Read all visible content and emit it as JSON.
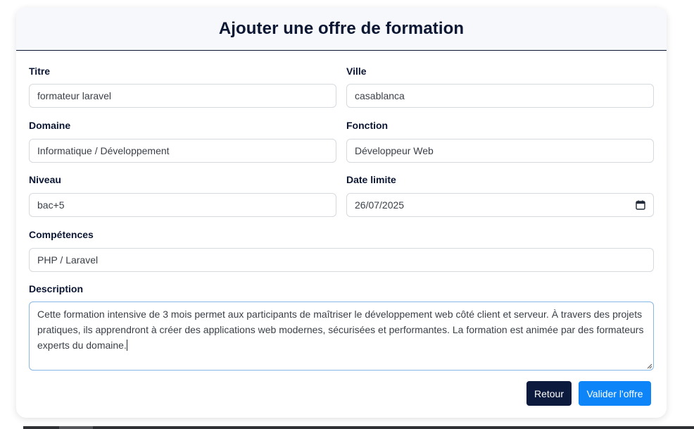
{
  "page": {
    "title": "Ajouter une offre de formation"
  },
  "fields": {
    "titre": {
      "label": "Titre",
      "value": "formateur laravel"
    },
    "ville": {
      "label": "Ville",
      "value": "casablanca"
    },
    "domaine": {
      "label": "Domaine",
      "value": "Informatique / Développement"
    },
    "fonction": {
      "label": "Fonction",
      "value": "Développeur Web"
    },
    "niveau": {
      "label": "Niveau",
      "value": "bac+5"
    },
    "date_limite": {
      "label": "Date limite",
      "value": "26/07/2025",
      "icon": "calendar-icon"
    },
    "competences": {
      "label": "Compétences",
      "value": "PHP / Laravel"
    },
    "description": {
      "label": "Description",
      "lines": [
        "Cette formation intensive de 3 mois permet aux participants de maîtriser le développement web côté client et serveur. À travers des projets",
        "pratiques, ils apprendront à créer des applications web modernes, sécurisées et performantes. La formation est animée par des formateurs",
        "experts du domaine."
      ]
    }
  },
  "buttons": {
    "back": "Retour",
    "submit": "Valider l'offre"
  },
  "colors": {
    "navy": "#0b1633",
    "primary": "#0d85f8",
    "back_button": "#0b1a3d",
    "focus_border": "#86b7e8"
  }
}
